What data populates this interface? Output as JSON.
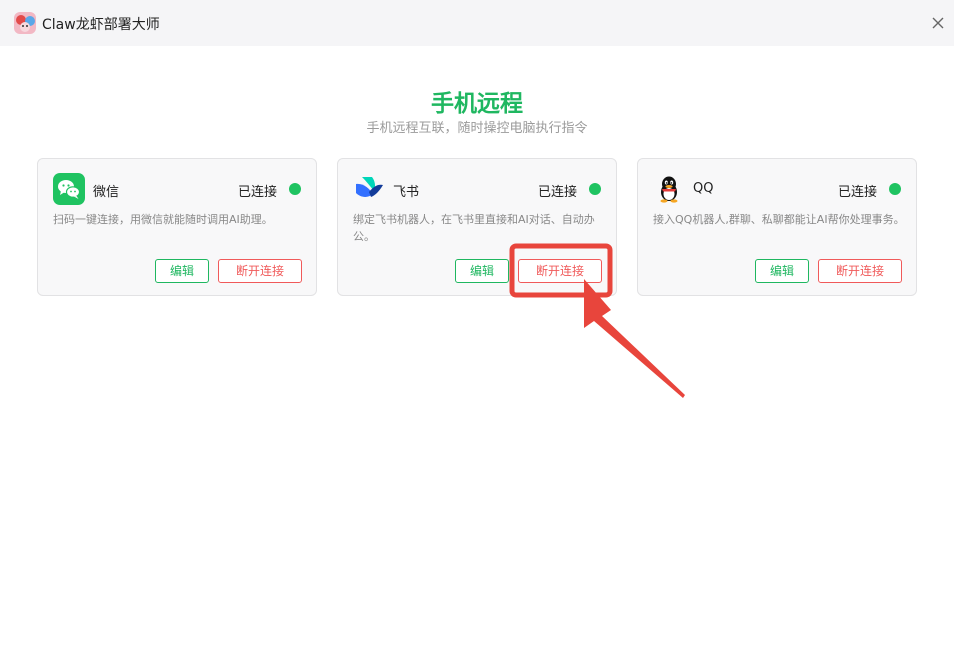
{
  "window": {
    "title": "Claw龙虾部署大师"
  },
  "header": {
    "title": "手机远程",
    "subtitle": "手机远程互联，随时操控电脑执行指令"
  },
  "cards": [
    {
      "name": "微信",
      "status": "已连接",
      "description": "扫码一键连接，用微信就能随时调用AI助理。",
      "edit_label": "编辑",
      "disconnect_label": "断开连接",
      "icon": "wechat-icon"
    },
    {
      "name": "飞书",
      "status": "已连接",
      "description": "绑定飞书机器人，在飞书里直接和AI对话、自动办公。",
      "edit_label": "编辑",
      "disconnect_label": "断开连接",
      "icon": "feishu-icon"
    },
    {
      "name": "QQ",
      "status": "已连接",
      "description": "接入QQ机器人,群聊、私聊都能让AI帮你处理事务。",
      "edit_label": "编辑",
      "disconnect_label": "断开连接",
      "icon": "qq-icon"
    }
  ],
  "colors": {
    "accent": "#1fb760",
    "status_connected": "#1fc361",
    "danger": "#f05a5a",
    "highlight": "#e8453c"
  }
}
